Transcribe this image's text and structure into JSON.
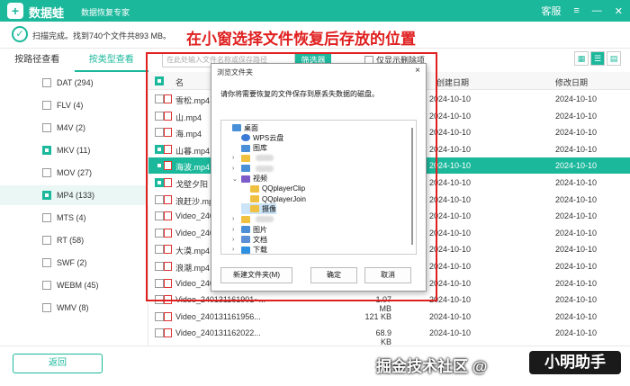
{
  "app": {
    "logo_glyph": "+",
    "name": "数据蛙",
    "subtitle": "数据恢复专家",
    "support": "客服",
    "menu_icon": "menu-icon",
    "minimize_icon": "minimize-icon",
    "close_icon": "close-icon"
  },
  "status": {
    "text": "扫描完成。找到740个文件共893 MB。"
  },
  "annotation": "在小窗选择文件恢复后存放的位置",
  "toolbar": {
    "tab_path": "按路径查看",
    "tab_type": "按类型查看",
    "search_placeholder": "在此处输入文件名称或保存路径",
    "filter_label": "筛选器",
    "deleted_only_label": "仅显示删除项"
  },
  "sidebar": {
    "items": [
      {
        "label": "DAT (294)",
        "checked": false
      },
      {
        "label": "FLV (4)",
        "checked": false
      },
      {
        "label": "M4V (2)",
        "checked": false
      },
      {
        "label": "MKV (11)",
        "checked": true
      },
      {
        "label": "MOV (27)",
        "checked": false
      },
      {
        "label": "MP4 (133)",
        "checked": true
      },
      {
        "label": "MTS (4)",
        "checked": false
      },
      {
        "label": "RT (58)",
        "checked": false
      },
      {
        "label": "SWF (2)",
        "checked": false
      },
      {
        "label": "WEBM (45)",
        "checked": false
      },
      {
        "label": "WMV (8)",
        "checked": false
      }
    ]
  },
  "table": {
    "header_name": "名",
    "header_created": "创建日期",
    "header_modified": "修改日期",
    "rows": [
      {
        "name": "雪松.mp4",
        "size": "",
        "created": "2024-10-10",
        "modified": "2024-10-10",
        "checked": false,
        "selected": false
      },
      {
        "name": "山.mp4",
        "size": "",
        "created": "2024-10-10",
        "modified": "2024-10-10",
        "checked": false,
        "selected": false
      },
      {
        "name": "海.mp4",
        "size": "",
        "created": "2024-10-10",
        "modified": "2024-10-10",
        "checked": false,
        "selected": false
      },
      {
        "name": "山暮.mp4",
        "size": "",
        "created": "2024-10-10",
        "modified": "2024-10-10",
        "checked": true,
        "selected": false
      },
      {
        "name": "海波.mp4",
        "size": "",
        "created": "2024-10-10",
        "modified": "2024-10-10",
        "checked": true,
        "selected": true
      },
      {
        "name": "戈壁夕阳",
        "size": "",
        "created": "2024-10-10",
        "modified": "2024-10-10",
        "checked": true,
        "selected": false
      },
      {
        "name": "浪赶沙.mp",
        "size": "",
        "created": "2024-10-10",
        "modified": "2024-10-10",
        "checked": false,
        "selected": false
      },
      {
        "name": "Video_2401",
        "size": "",
        "created": "2024-10-10",
        "modified": "2024-10-10",
        "checked": false,
        "selected": false
      },
      {
        "name": "Video_2401",
        "size": "",
        "created": "2024-10-10",
        "modified": "2024-10-10",
        "checked": false,
        "selected": false
      },
      {
        "name": "大漠.mp4",
        "size": "",
        "created": "2024-10-10",
        "modified": "2024-10-10",
        "checked": false,
        "selected": false
      },
      {
        "name": "浪潮.mp4",
        "size": "",
        "created": "2024-10-10",
        "modified": "2024-10-10",
        "checked": false,
        "selected": false
      },
      {
        "name": "Video_2401",
        "size": "",
        "created": "2024-10-10",
        "modified": "2024-10-10",
        "checked": false,
        "selected": false
      },
      {
        "name": "Video_240131161901~...",
        "size": "1.07 MB",
        "created": "2024-10-10",
        "modified": "2024-10-10",
        "checked": false,
        "selected": false
      },
      {
        "name": "Video_240131161956...",
        "size": "121 KB",
        "created": "2024-10-10",
        "modified": "2024-10-10",
        "checked": false,
        "selected": false
      },
      {
        "name": "Video_240131162022...",
        "size": "68.9 KB",
        "created": "2024-10-10",
        "modified": "2024-10-10",
        "checked": false,
        "selected": false
      }
    ]
  },
  "bottom": {
    "back_label": "返回"
  },
  "watermark": {
    "text": "掘金技术社区 @",
    "pill": "小明助手"
  },
  "dialog": {
    "title": "浏览文件夹",
    "close_glyph": "×",
    "message": "请你将需要恢复的文件保存到原丢失数据的磁盘。",
    "tree": [
      {
        "label": "桌面",
        "level": 0,
        "icon": "desktop-folder-icon",
        "chev": ""
      },
      {
        "label": "WPS云盘",
        "level": 1,
        "icon": "cloud-icon",
        "chev": ""
      },
      {
        "label": "图库",
        "level": 1,
        "icon": "gallery-icon",
        "chev": ""
      },
      {
        "label": "",
        "level": 1,
        "icon": "user-icon",
        "chev": "›"
      },
      {
        "label": "",
        "level": 1,
        "icon": "pc-icon",
        "chev": "›"
      },
      {
        "label": "视频",
        "level": 1,
        "icon": "video-folder-icon",
        "chev": "⌄"
      },
      {
        "label": "QQplayerClip",
        "level": 2,
        "icon": "folder-icon",
        "chev": ""
      },
      {
        "label": "QQplayerJoin",
        "level": 2,
        "icon": "folder-icon",
        "chev": ""
      },
      {
        "label": "摄像",
        "level": 2,
        "icon": "folder-icon",
        "chev": "",
        "selected": true
      },
      {
        "label": "",
        "level": 1,
        "icon": "folder-icon",
        "chev": "›"
      },
      {
        "label": "图片",
        "level": 1,
        "icon": "pictures-folder-icon",
        "chev": "›"
      },
      {
        "label": "文档",
        "level": 1,
        "icon": "documents-folder-icon",
        "chev": "›"
      },
      {
        "label": "下载",
        "level": 1,
        "icon": "downloads-folder-icon",
        "chev": "›"
      }
    ],
    "new_folder": "新建文件夹(M)",
    "ok": "确定",
    "cancel": "取消"
  }
}
